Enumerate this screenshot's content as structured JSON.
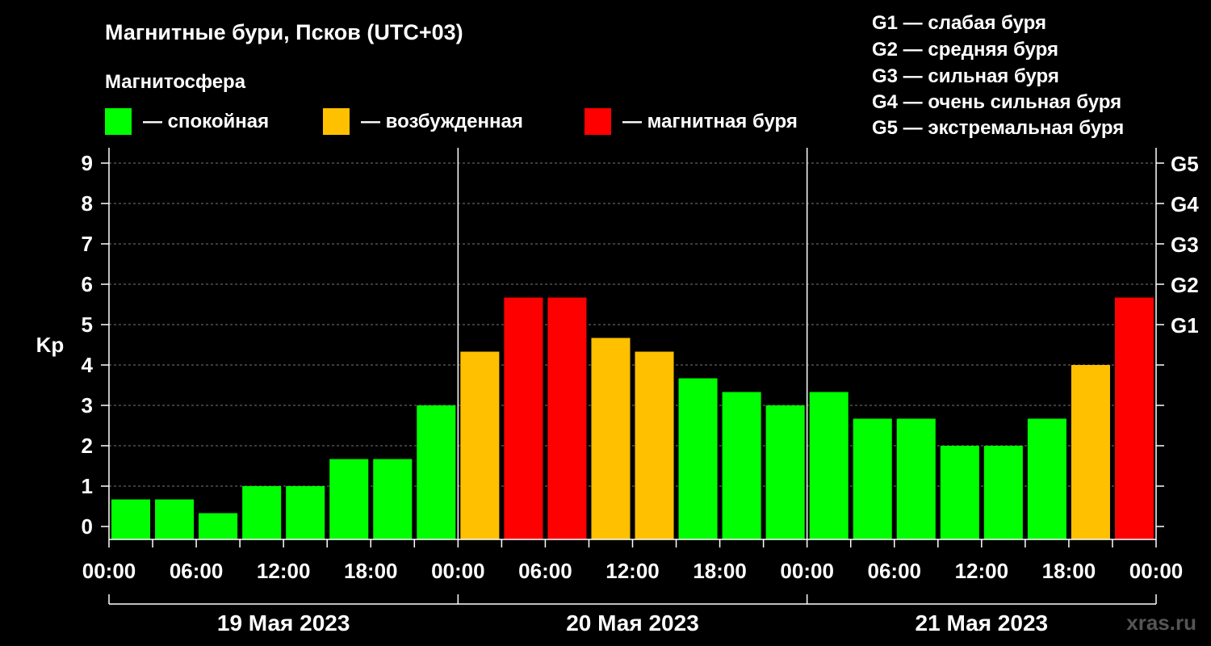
{
  "title": "Магнитные бури, Псков (UTC+03)",
  "subtitle": "Магнитосфера",
  "legend": [
    {
      "color": "#00ff00",
      "label": "— спокойная"
    },
    {
      "color": "#ffc000",
      "label": "— возбужденная"
    },
    {
      "color": "#ff0000",
      "label": "— магнитная буря"
    }
  ],
  "g_legend": [
    "G1 — слабая буря",
    "G2 — средняя буря",
    "G3 — сильная буря",
    "G4 — очень сильная буря",
    "G5 — экстремальная буря"
  ],
  "watermark": "xras.ru",
  "chart_data": {
    "type": "bar",
    "ylabel": "Kp",
    "ylim": [
      0,
      9
    ],
    "y_ticks": [
      0,
      1,
      2,
      3,
      4,
      5,
      6,
      7,
      8,
      9
    ],
    "right_ticks": [
      {
        "value": 5,
        "label": "G1"
      },
      {
        "value": 6,
        "label": "G2"
      },
      {
        "value": 7,
        "label": "G3"
      },
      {
        "value": 8,
        "label": "G4"
      },
      {
        "value": 9,
        "label": "G5"
      }
    ],
    "x_tick_labels": [
      "00:00",
      "06:00",
      "12:00",
      "18:00",
      "00:00",
      "06:00",
      "12:00",
      "18:00",
      "00:00",
      "06:00",
      "12:00",
      "18:00",
      "00:00"
    ],
    "days": [
      "19 Мая 2023",
      "20 Мая 2023",
      "21 Мая 2023"
    ],
    "interval_hours": 3,
    "values": [
      0.67,
      0.67,
      0.33,
      1.0,
      1.0,
      1.67,
      1.67,
      3.0,
      4.33,
      5.67,
      5.67,
      4.67,
      4.33,
      3.67,
      3.33,
      3.0,
      3.33,
      2.67,
      2.67,
      2.0,
      2.0,
      2.67,
      4.0,
      5.67
    ],
    "levels": [
      "quiet",
      "quiet",
      "quiet",
      "quiet",
      "quiet",
      "quiet",
      "quiet",
      "quiet",
      "active",
      "storm",
      "storm",
      "active",
      "active",
      "quiet",
      "quiet",
      "quiet",
      "quiet",
      "quiet",
      "quiet",
      "quiet",
      "quiet",
      "quiet",
      "active",
      "storm"
    ],
    "level_colors": {
      "quiet": "#00ff00",
      "active": "#ffc000",
      "storm": "#ff0000"
    },
    "grid": true
  }
}
